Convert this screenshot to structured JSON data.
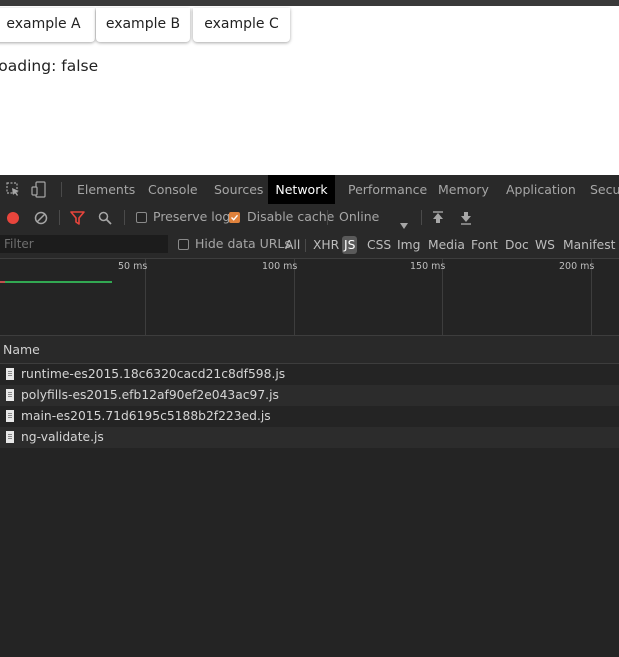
{
  "page": {
    "buttons": [
      "example A",
      "example B",
      "example C"
    ],
    "loading_text": "loading: false"
  },
  "devtools": {
    "tabs": [
      "Elements",
      "Console",
      "Sources",
      "Network",
      "Performance",
      "Memory",
      "Application",
      "Security"
    ],
    "active_tab": "Network",
    "toolbar": {
      "preserve_log_label": "Preserve log",
      "preserve_log_checked": false,
      "disable_cache_label": "Disable cache",
      "disable_cache_checked": true,
      "throttle_value": "Online"
    },
    "filter": {
      "placeholder": "Filter",
      "hide_data_urls_label": "Hide data URLs",
      "hide_data_urls_checked": false,
      "types": [
        "All",
        "XHR",
        "JS",
        "CSS",
        "Img",
        "Media",
        "Font",
        "Doc",
        "WS",
        "Manifest"
      ],
      "active_type": "JS"
    },
    "timeline": {
      "ticks": [
        "50 ms",
        "100 ms",
        "150 ms",
        "200 ms"
      ]
    },
    "requests": {
      "column_header": "Name",
      "rows": [
        "runtime-es2015.18c6320cacd21c8df598.js",
        "polyfills-es2015.efb12af90ef2e043ac97.js",
        "main-es2015.71d6195c5188b2f223ed.js",
        "ng-validate.js"
      ]
    }
  },
  "colors": {
    "record_red": "#e8453c",
    "filter_red": "#e8453c",
    "checkbox_orange": "#e0823c",
    "waterfall_green": "#32a852"
  },
  "icons": [
    "inspect-element-icon",
    "device-toolbar-icon",
    "record-icon",
    "clear-icon",
    "filter-icon",
    "search-icon",
    "dropdown-arrow-icon",
    "import-har-icon",
    "export-har-icon",
    "file-icon"
  ]
}
